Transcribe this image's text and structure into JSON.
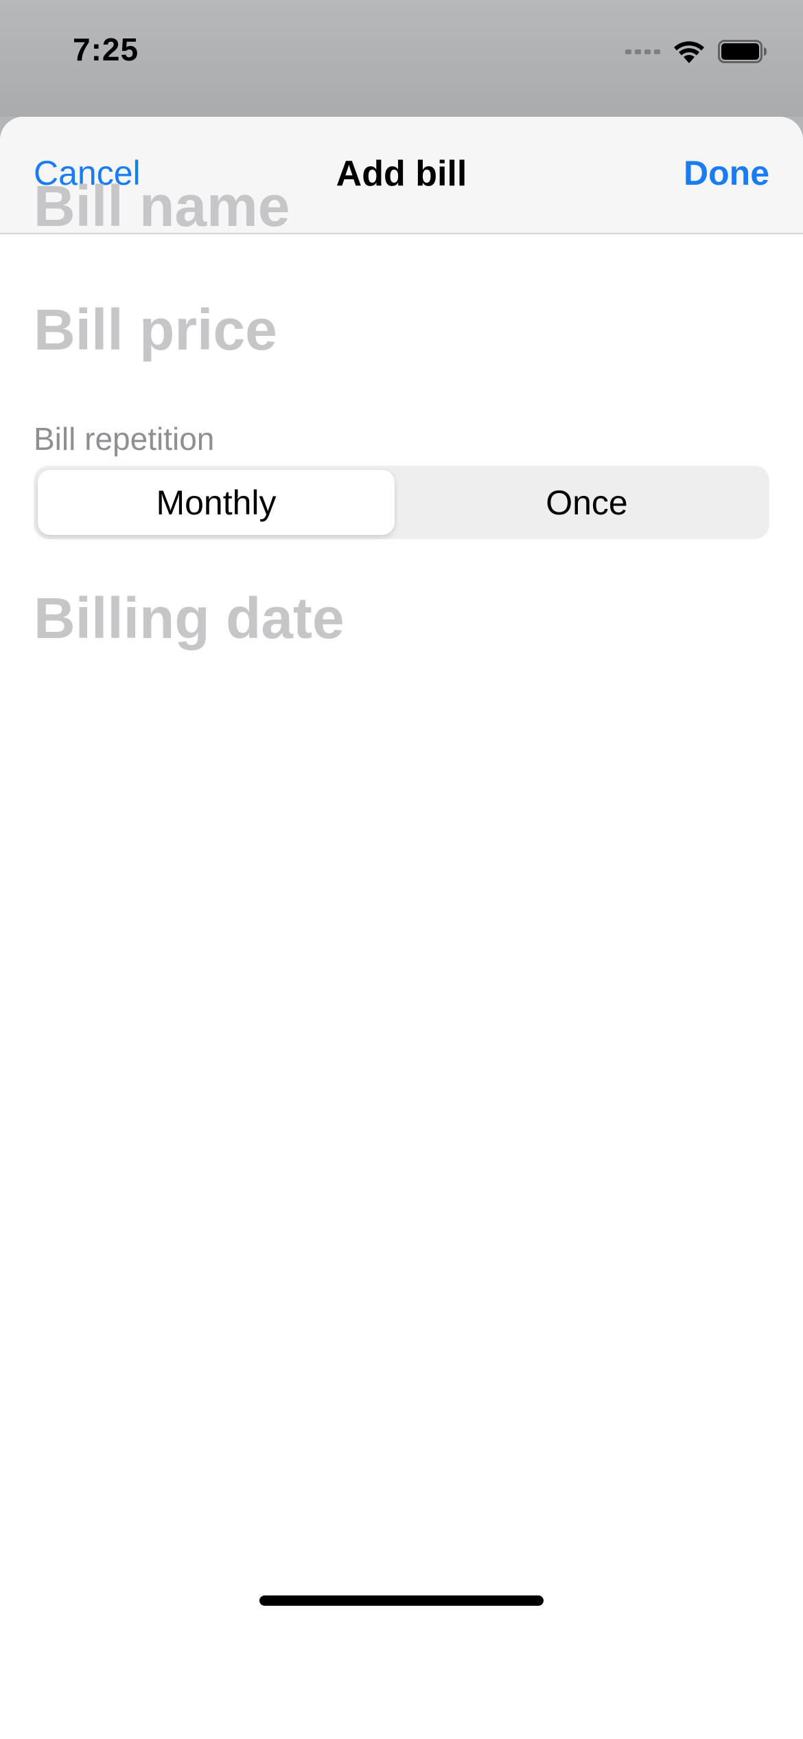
{
  "status_bar": {
    "time": "7:25"
  },
  "nav": {
    "cancel_label": "Cancel",
    "title": "Add bill",
    "done_label": "Done"
  },
  "form": {
    "bill_name": {
      "placeholder": "Bill name",
      "value": ""
    },
    "bill_price": {
      "placeholder": "Bill price",
      "value": ""
    },
    "repetition": {
      "label": "Bill repetition",
      "options": [
        "Monthly",
        "Once"
      ],
      "selected": "Monthly"
    },
    "billing_date": {
      "placeholder": "Billing date",
      "value": ""
    }
  },
  "colors": {
    "accent": "#1a7cf3",
    "placeholder": "#c6c6c8",
    "secondary_label": "#8e8e93"
  }
}
